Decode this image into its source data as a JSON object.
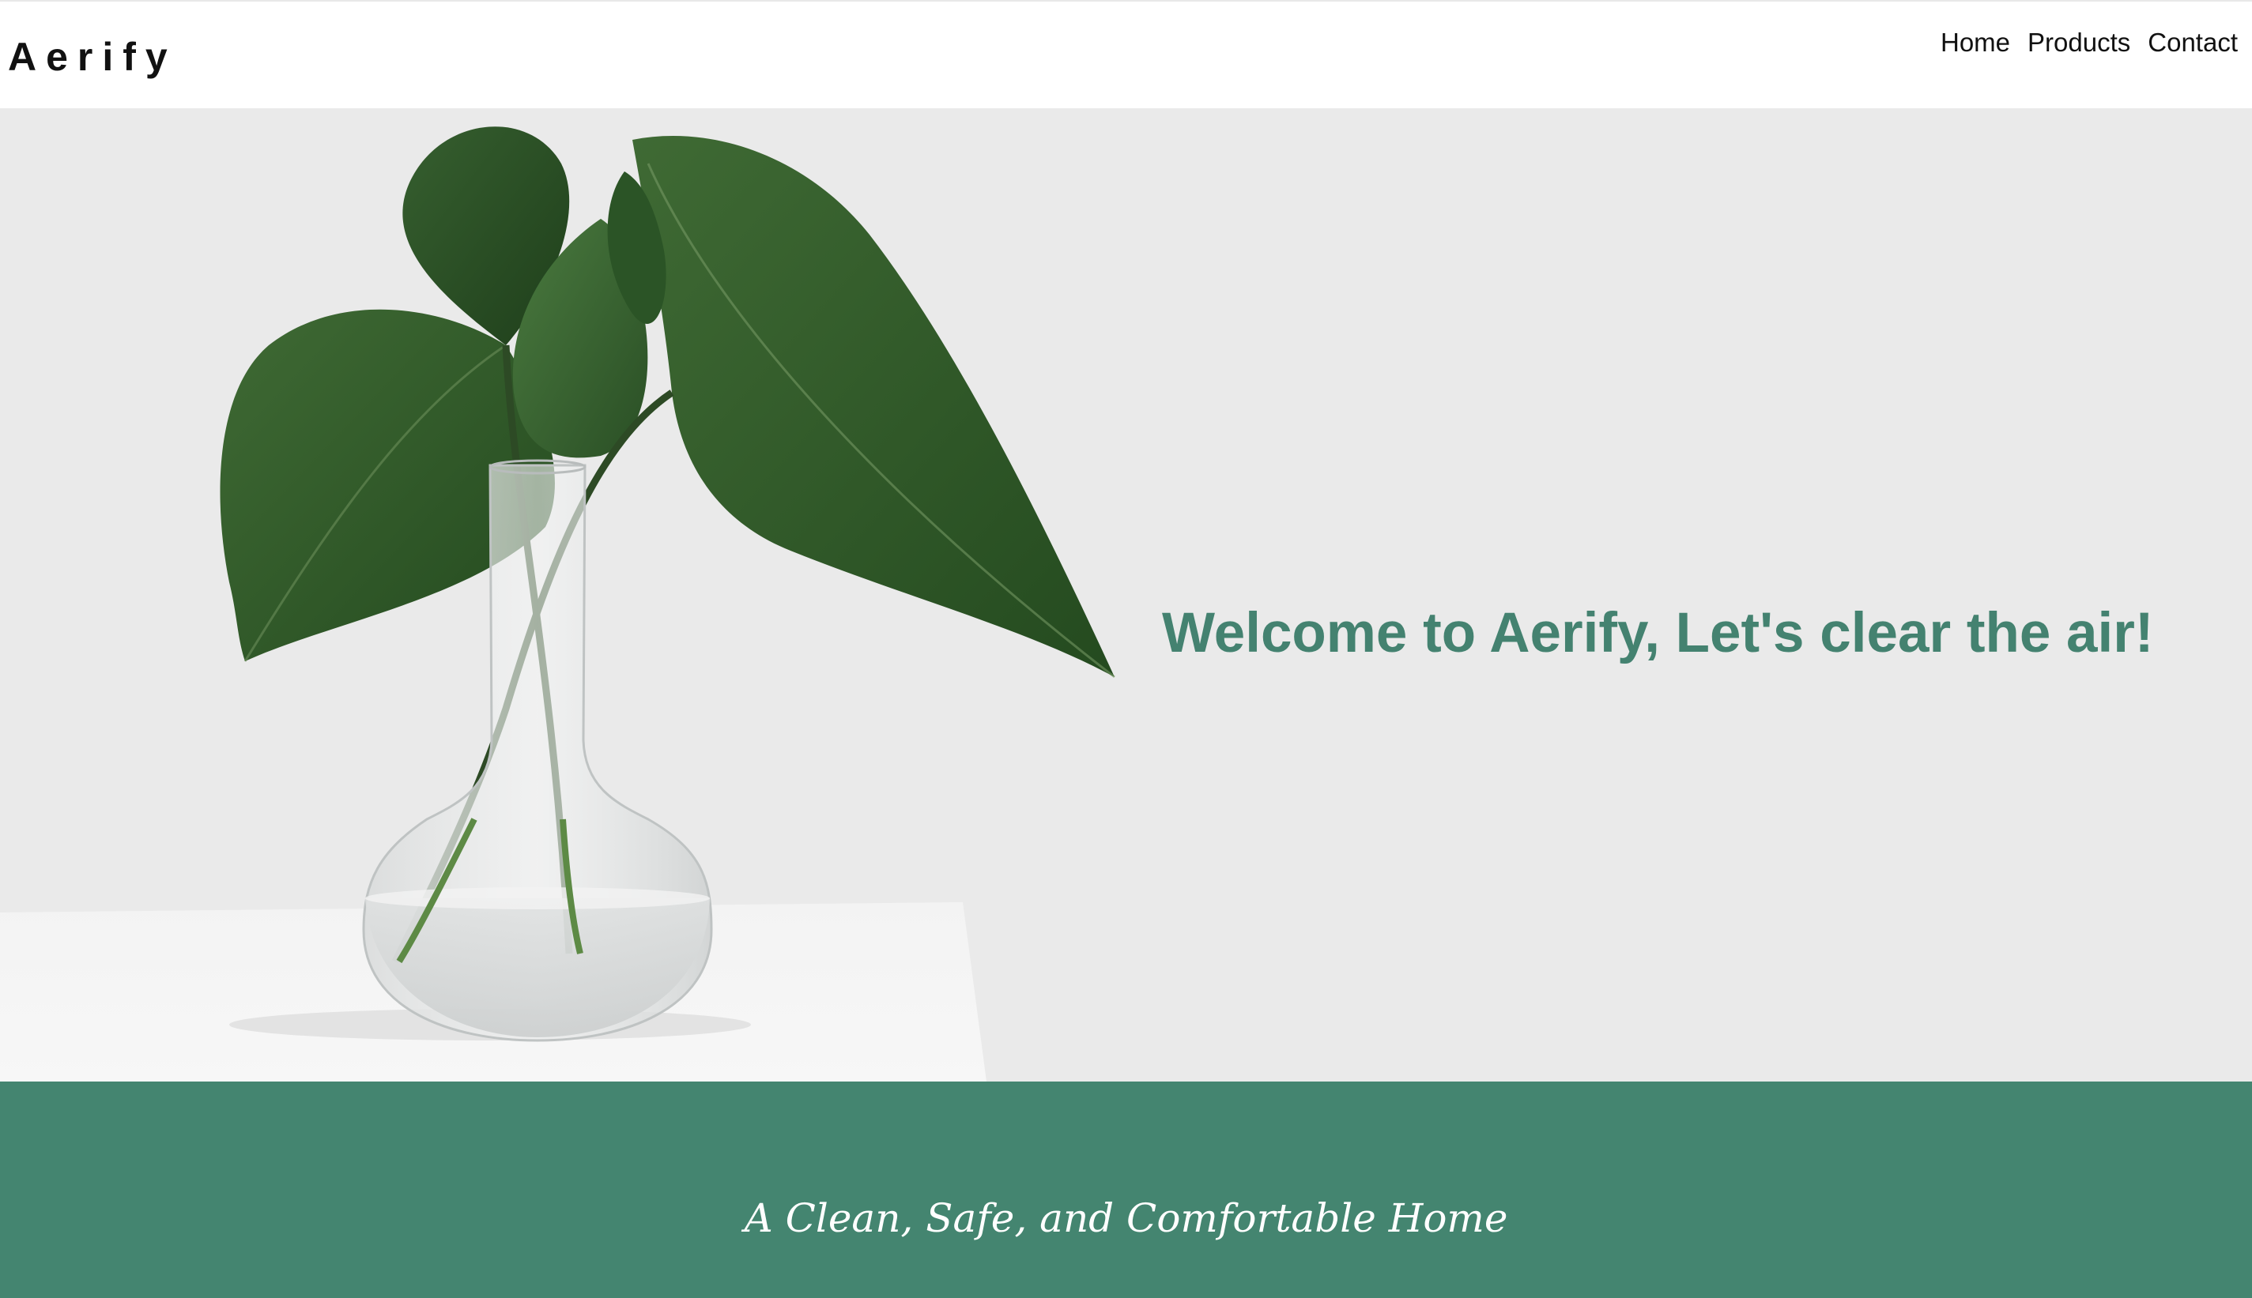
{
  "header": {
    "brand": "Aerify",
    "nav": [
      {
        "label": "Home"
      },
      {
        "label": "Products"
      },
      {
        "label": "Contact"
      }
    ]
  },
  "hero": {
    "title": "Welcome to Aerify, Let's clear the air!",
    "image_subject": "green leaves in a glass vase on a white table"
  },
  "band": {
    "text": "A Clean, Safe, and Comfortable Home"
  },
  "colors": {
    "accent": "#448270",
    "band_background": "#448570",
    "hero_background": "#eaeaea",
    "header_background": "#ffffff",
    "text_dark": "#111111"
  }
}
